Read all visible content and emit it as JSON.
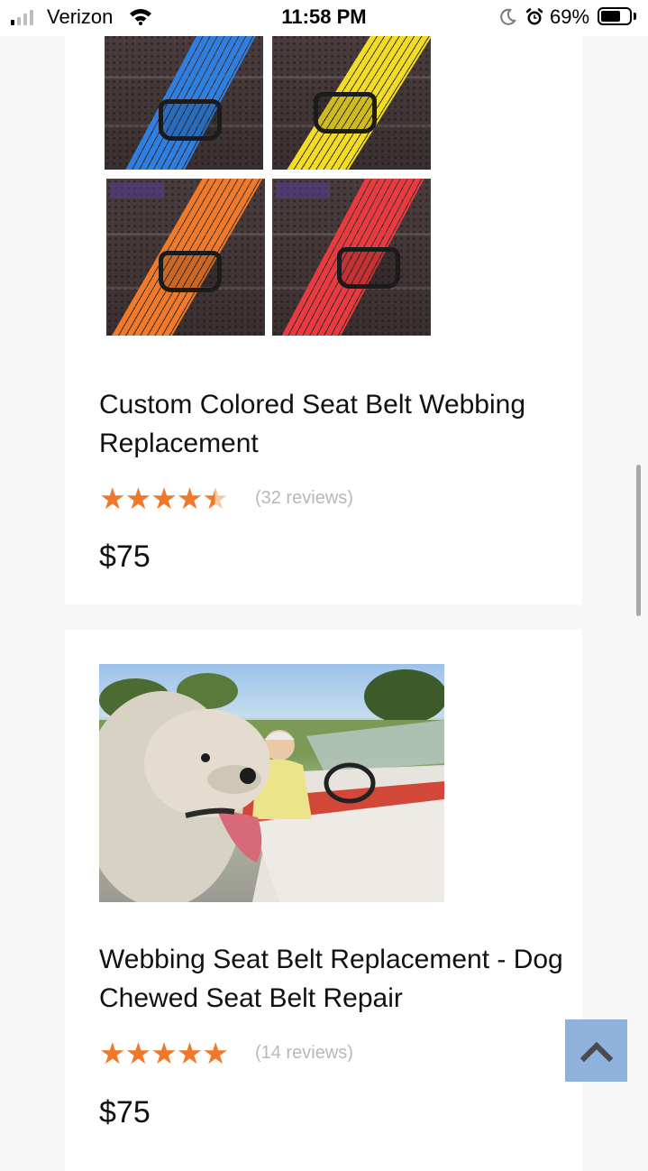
{
  "status_bar": {
    "carrier": "Verizon",
    "time": "11:58 PM",
    "battery_percent": "69%",
    "battery_level": 0.69,
    "signal_bars_active": 1,
    "signal_bars_total": 4
  },
  "products": [
    {
      "title": "Custom Colored Seat Belt Webbing Replacement",
      "rating": 4.5,
      "reviews": "(32 reviews)",
      "price": "$75",
      "image_icon": "seat-belt-colors-collage"
    },
    {
      "title": "Webbing Seat Belt Replacement - Dog Chewed Seat Belt Repair",
      "rating": 5,
      "reviews": "(14 reviews)",
      "price": "$75",
      "image_icon": "dog-in-convertible-photo"
    }
  ],
  "colors": {
    "star": "#f0782a",
    "back_to_top": "#8fb2dd",
    "strap_blue": "#2f7fe0",
    "strap_yellow": "#f2dd24",
    "strap_orange": "#f07a2a",
    "strap_red": "#e83a3f"
  },
  "icons": {
    "back_to_top": "chevron-up-icon"
  }
}
